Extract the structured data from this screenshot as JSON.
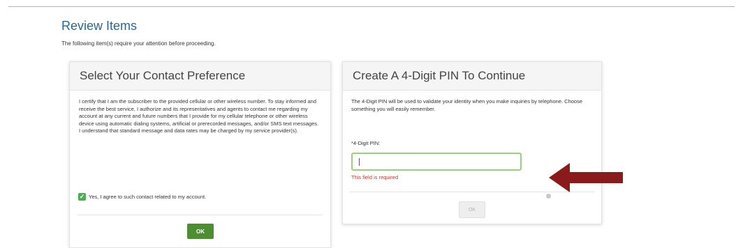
{
  "page": {
    "title": "Review Items",
    "subtitle": "The following item(s) require your attention before proceeding."
  },
  "contact_card": {
    "header": "Select Your Contact Preference",
    "consent_text": "I certify that I am the subscriber to the provided cellular or other wireless number. To stay informed and receive the best service, I authorize and its representatives and agents to contact me regarding my account at any current and future numbers that I provide for my cellular telephone or other wireless device using automatic dialing systems, artificial or prerecorded messages, and/or SMS text messages. I understand that standard message and data rates may be charged by my service provider(s).",
    "checkbox_label": "Yes, I agree to such contact related to my account.",
    "checkbox_checked": true,
    "ok_label": "OK"
  },
  "pin_card": {
    "header": "Create A 4-Digit PIN To Continue",
    "description": "The 4-Digit PIN will be used to validate your identity when you make inquiries by telephone. Choose something you will easily remember.",
    "field_label": "*4-Digit PIN:",
    "field_value": "",
    "error_text": "This field is required",
    "ok_label": "OK"
  },
  "colors": {
    "title": "#2a6790",
    "ok_button": "#4c8e30",
    "error": "#c0392b",
    "input_border": "#9ccf7a",
    "arrow": "#8b1a1a"
  },
  "icons": {
    "checkbox": "check-icon",
    "annotation": "red-arrow-icon"
  }
}
